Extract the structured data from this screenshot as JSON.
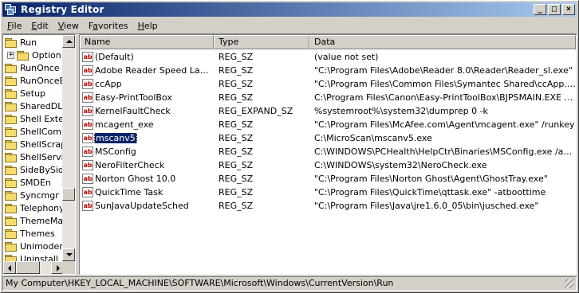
{
  "window": {
    "title": "Registry Editor"
  },
  "title_buttons": {
    "minimize": "_",
    "maximize": "□",
    "close": "×"
  },
  "menu": [
    "File",
    "Edit",
    "View",
    "Favorites",
    "Help"
  ],
  "menu_mnemonics": [
    "F",
    "E",
    "V",
    "a",
    "H"
  ],
  "tree": {
    "items": [
      "Run",
      "Option",
      "RunOnce",
      "RunOnceE",
      "Setup",
      "SharedDLL",
      "Shell Exter",
      "ShellCompa",
      "ShellScrap",
      "ShellServic",
      "SideBySide",
      "SMDEn",
      "Syncmgr",
      "Telephony",
      "ThemeMan",
      "Themes",
      "Unimodem",
      "Uninstall"
    ],
    "expander": "+"
  },
  "list": {
    "columns": [
      "Name",
      "Type",
      "Data"
    ],
    "rows": [
      {
        "name": "(Default)",
        "type": "REG_SZ",
        "data": "(value not set)"
      },
      {
        "name": "Adobe Reader Speed Launc...",
        "type": "REG_SZ",
        "data": "\"C:\\Program Files\\Adobe\\Reader 8.0\\Reader\\Reader_sl.exe\""
      },
      {
        "name": "ccApp",
        "type": "REG_SZ",
        "data": "\"C:\\Program Files\\Common Files\\Symantec Shared\\ccApp.exe\""
      },
      {
        "name": "Easy-PrintToolBox",
        "type": "REG_SZ",
        "data": "C:\\Program Files\\Canon\\Easy-PrintToolBox\\BJPSMAIN.EXE /logon"
      },
      {
        "name": "KernelFaultCheck",
        "type": "REG_EXPAND_SZ",
        "data": "%systemroot%\\system32\\dumprep 0 -k"
      },
      {
        "name": "mcagent_exe",
        "type": "REG_SZ",
        "data": "\"C:\\Program Files\\McAfee.com\\Agent\\mcagent.exe\" /runkey"
      },
      {
        "name": "mscanv5",
        "type": "REG_SZ",
        "data": "C:\\MicroScan\\mscanv5.exe"
      },
      {
        "name": "MSConfig",
        "type": "REG_SZ",
        "data": "C:\\WINDOWS\\PCHealth\\HelpCtr\\Binaries\\MSConfig.exe /auto"
      },
      {
        "name": "NeroFilterCheck",
        "type": "REG_SZ",
        "data": "C:\\WINDOWS\\system32\\NeroCheck.exe"
      },
      {
        "name": "Norton Ghost 10.0",
        "type": "REG_SZ",
        "data": "\"C:\\Program Files\\Norton Ghost\\Agent\\GhostTray.exe\""
      },
      {
        "name": "QuickTime Task",
        "type": "REG_SZ",
        "data": "\"C:\\Program Files\\QuickTime\\qttask.exe\" -atboottime"
      },
      {
        "name": "SunJavaUpdateSched",
        "type": "REG_SZ",
        "data": "\"C:\\Program Files\\Java\\jre1.6.0_05\\bin\\jusched.exe\""
      }
    ],
    "value_icon": "ab",
    "selected_index": 6
  },
  "status": {
    "path": "My Computer\\HKEY_LOCAL_MACHINE\\SOFTWARE\\Microsoft\\Windows\\CurrentVersion\\Run"
  },
  "colors": {
    "titlebar_start": "#0a246a",
    "titlebar_end": "#a6caf0",
    "selection": "#0a246a",
    "chrome": "#d4d0c8"
  }
}
